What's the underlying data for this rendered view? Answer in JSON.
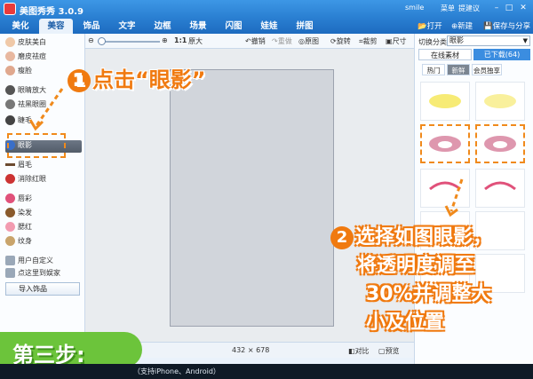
{
  "app": {
    "title": "美图秀秀 3.0.9",
    "user": "smile",
    "menu": "菜单",
    "feedback": "提建议"
  },
  "tabs": [
    "美化",
    "美容",
    "饰品",
    "文字",
    "边框",
    "场景",
    "闪图",
    "娃娃",
    "拼图"
  ],
  "active_tab": "美容",
  "tab_actions": {
    "open": "打开",
    "new": "新建",
    "save_share": "保存与分享"
  },
  "toolbar": {
    "zoom_ratio": "1:1",
    "original_size": "原大",
    "undo": "撤销",
    "redo": "重做",
    "original": "原图",
    "rotate": "旋转",
    "crop": "裁剪",
    "resize": "尺寸"
  },
  "left_menu": [
    "皮肤美白",
    "磨皮祛痘",
    "瘦脸",
    "眼睛放大",
    "祛黑眼圈",
    "睫毛",
    "眼影",
    "眉毛",
    "消除红眼",
    "唇彩",
    "染发",
    "腮红",
    "纹身"
  ],
  "left_extra": {
    "custom": "用户自定义",
    "set_favorite": "点这里到娱家",
    "import": "导入饰品"
  },
  "right_panel": {
    "switch_label": "切换分类",
    "category": "眼影",
    "tab_online": "在线素材",
    "tab_downloaded": "已下载(64)",
    "subtabs": [
      "热门",
      "新鲜",
      "会员独享"
    ],
    "active_subtab": "新鲜"
  },
  "status": {
    "width": "432",
    "times": "×",
    "height": "678",
    "compare": "对比",
    "preview": "预览"
  },
  "overlay": {
    "step1_num": "1",
    "step1_text": "点击“眼影”",
    "step2_num": "2",
    "step2_lines": [
      "选择如图眼影，",
      "将透明度调至",
      "30%并调整大",
      "小及位置"
    ],
    "step_banner": "第三步:"
  },
  "bottom_note": "（支持iPhone、Android）",
  "colors": {
    "accent_orange": "#f07a10",
    "title_blue": "#2a7fd2",
    "banner_green": "#6cc43b"
  }
}
